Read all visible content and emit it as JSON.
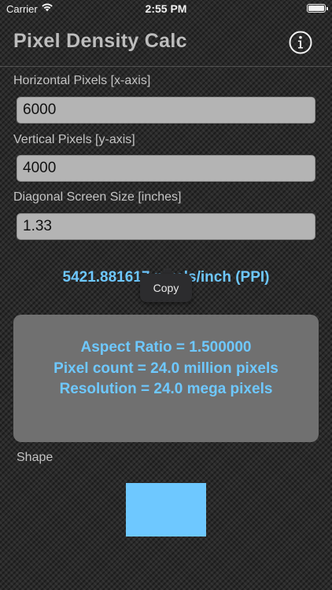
{
  "status_bar": {
    "carrier": "Carrier",
    "time": "2:55 PM"
  },
  "header": {
    "title": "Pixel Density Calc",
    "info_icon": "info-circle-icon"
  },
  "fields": [
    {
      "label": "Horizontal Pixels  [x-axis]",
      "value": "6000"
    },
    {
      "label": "Vertical Pixels [y-axis]",
      "value": "4000"
    },
    {
      "label": "Diagonal Screen Size [inches]",
      "value": "1.33"
    }
  ],
  "result": {
    "ppi_text": "5421.881617 pixels/inch (PPI)"
  },
  "context_menu": {
    "copy_label": "Copy"
  },
  "stats": [
    "Aspect Ratio = 1.500000",
    "Pixel count = 24.0 million pixels",
    "Resolution = 24.0 mega pixels"
  ],
  "shape": {
    "label": "Shape",
    "color": "#6ec8ff"
  },
  "colors": {
    "accent": "#6ec8ff",
    "panel": "#707070",
    "input_bg": "#b4b4b4"
  }
}
